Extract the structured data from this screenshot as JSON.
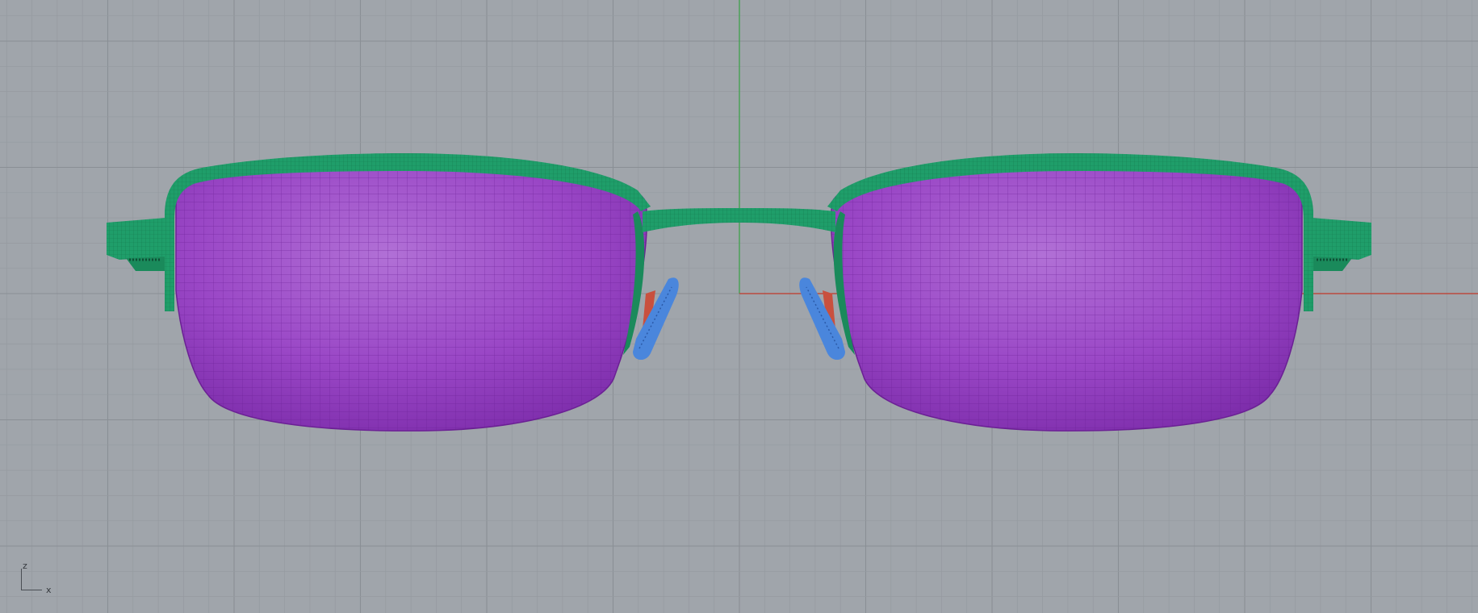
{
  "viewport": {
    "view": "Front",
    "background_color": "#a0a5ab",
    "grid_minor_color": "#959aa0",
    "grid_major_color": "#8a8f95",
    "x_axis_color": "#c0392b",
    "z_axis_color": "#3fa34d"
  },
  "axis_widget": {
    "z_label": "z",
    "x_label": "x"
  },
  "model": {
    "object": "sunglasses",
    "frame_color": "#1f9e6a",
    "lens_color": "#9b45c2",
    "nose_pad_color": "#4a86dc",
    "pad_arm_color": "#c9503e"
  }
}
